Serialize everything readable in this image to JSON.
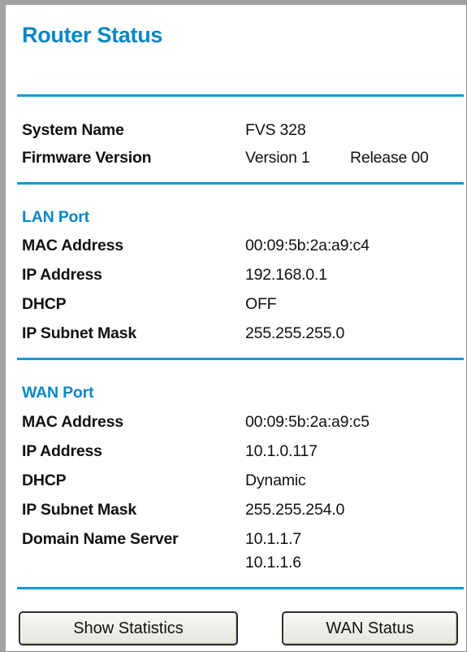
{
  "title": "Router Status",
  "system": {
    "name_label": "System Name",
    "name_value": "FVS 328",
    "firmware_label": "Firmware Version",
    "firmware_version": "Version 1",
    "firmware_release": "Release 00"
  },
  "lan": {
    "heading": "LAN Port",
    "mac_label": "MAC Address",
    "mac_value": "00:09:5b:2a:a9:c4",
    "ip_label": "IP Address",
    "ip_value": "192.168.0.1",
    "dhcp_label": "DHCP",
    "dhcp_value": "OFF",
    "mask_label": "IP Subnet Mask",
    "mask_value": "255.255.255.0"
  },
  "wan": {
    "heading": "WAN Port",
    "mac_label": "MAC Address",
    "mac_value": "00:09:5b:2a:a9:c5",
    "ip_label": "IP Address",
    "ip_value": "10.1.0.117",
    "dhcp_label": "DHCP",
    "dhcp_value": "Dynamic",
    "mask_label": "IP Subnet Mask",
    "mask_value": "255.255.254.0",
    "dns_label": "Domain Name Server",
    "dns_values": [
      "10.1.1.7",
      "10.1.1.6"
    ]
  },
  "buttons": {
    "show_statistics": "Show Statistics",
    "wan_status": "WAN Status"
  },
  "colors": {
    "accent": "#0a86c4",
    "rule": "#0a9ad6",
    "frame": "#a3a3a3"
  }
}
